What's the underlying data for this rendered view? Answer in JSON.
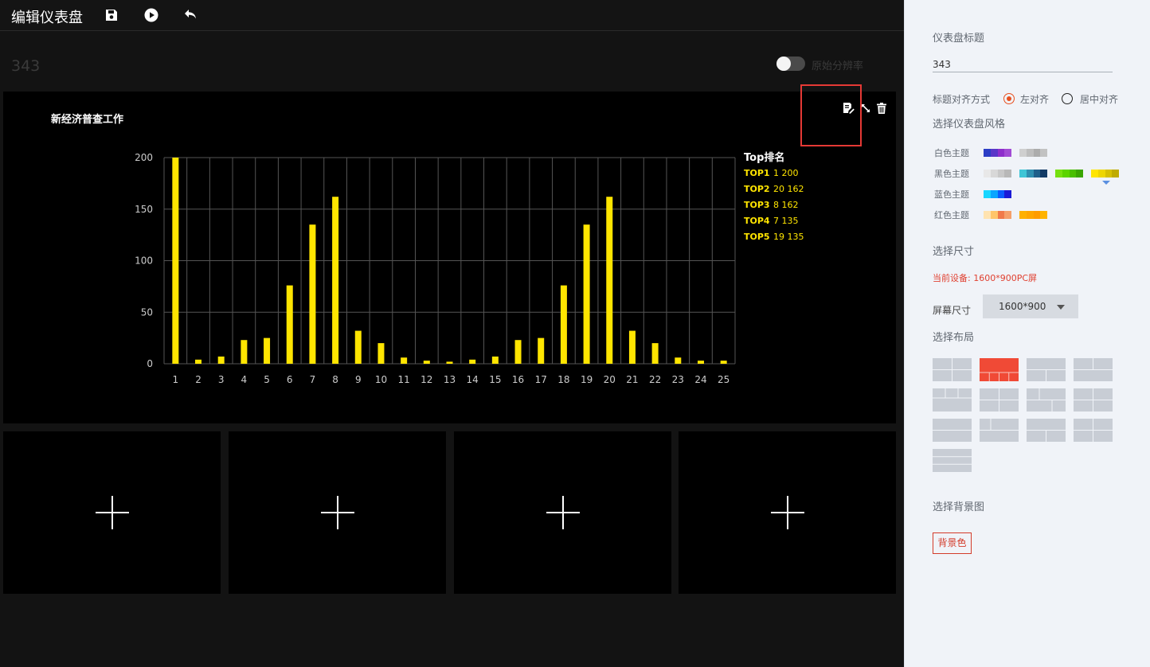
{
  "topbar": {
    "title": "编辑仪表盘",
    "icons": [
      "save-icon",
      "play-icon",
      "undo-icon"
    ]
  },
  "dashboard": {
    "title": "343",
    "toggle_label": "原始分辨率",
    "toggle_on": false
  },
  "panel": {
    "title": "新经济普查工作",
    "icons": [
      "edit-icon",
      "expand-icon",
      "delete-icon"
    ]
  },
  "chart_data": {
    "type": "bar",
    "title": "新经济普查工作",
    "categories": [
      "1",
      "2",
      "3",
      "4",
      "5",
      "6",
      "7",
      "8",
      "9",
      "10",
      "11",
      "12",
      "13",
      "14",
      "15",
      "16",
      "17",
      "18",
      "19",
      "20",
      "21",
      "22",
      "23",
      "24",
      "25"
    ],
    "values": [
      200,
      4,
      7,
      23,
      25,
      76,
      135,
      162,
      32,
      20,
      6,
      3,
      2,
      4,
      7,
      23,
      25,
      76,
      135,
      162,
      32,
      20,
      6,
      3,
      3
    ],
    "yticks": [
      "0",
      "50",
      "100",
      "150",
      "200"
    ],
    "ylim": [
      0,
      200
    ],
    "grid": true,
    "bar_color": "#ffe500",
    "ranking": {
      "title": "Top排名",
      "items": [
        {
          "label": "TOP1",
          "value": "1 200"
        },
        {
          "label": "TOP2",
          "value": "20 162"
        },
        {
          "label": "TOP3",
          "value": "8 162"
        },
        {
          "label": "TOP4",
          "value": "7 135"
        },
        {
          "label": "TOP5",
          "value": "19 135"
        }
      ]
    }
  },
  "slots": [
    {
      "icon": "plus-icon"
    },
    {
      "icon": "plus-icon"
    },
    {
      "icon": "plus-icon"
    },
    {
      "icon": "plus-icon"
    }
  ],
  "sidebar": {
    "title_label": "仪表盘标题",
    "title_value": "343",
    "align_label": "标题对齐方式",
    "align_options": [
      "左对齐",
      "居中对齐"
    ],
    "align_selected": "左对齐",
    "style_label": "选择仪表盘风格",
    "themes": [
      {
        "name": "白色主题",
        "swatches": [
          [
            "#2c3ec5",
            "#5a36c8",
            "#8e2ecb",
            "#a24bd4"
          ],
          [
            "#cfcfcf",
            "#bdbdbd",
            "#acacac",
            "#c2c2c2"
          ]
        ]
      },
      {
        "name": "黑色主题",
        "swatches": [
          [
            "#e8e8e8",
            "#d8d8d8",
            "#c8c8c8",
            "#b8b8b8"
          ],
          [
            "#3ec5d6",
            "#2f8fb0",
            "#1f5f8a",
            "#123a66"
          ],
          [
            "#76e010",
            "#5cd400",
            "#49bf00",
            "#3aa500"
          ],
          [
            "#ffe500",
            "#eed600",
            "#d6c000",
            "#bfab00"
          ]
        ]
      },
      {
        "name": "蓝色主题",
        "swatches": [
          [
            "#18d6ff",
            "#0aa6ff",
            "#0a5dff",
            "#1a1ad6"
          ]
        ]
      },
      {
        "name": "红色主题",
        "swatches": [
          [
            "#ffe3b0",
            "#ffc56a",
            "#f07a4a",
            "#f5a06a"
          ],
          [
            "#ffb000",
            "#ffa600",
            "#ff9c00",
            "#ffb300"
          ]
        ]
      }
    ],
    "size_label": "选择尺寸",
    "device_text": "当前设备: 1600*900PC屏",
    "screen_size_label": "屏幕尺寸",
    "screen_size_value": "1600*900",
    "layout_label": "选择布局",
    "layout_count": 13,
    "layout_selected": 2,
    "background_label": "选择背景图",
    "background_button": "背景色"
  }
}
